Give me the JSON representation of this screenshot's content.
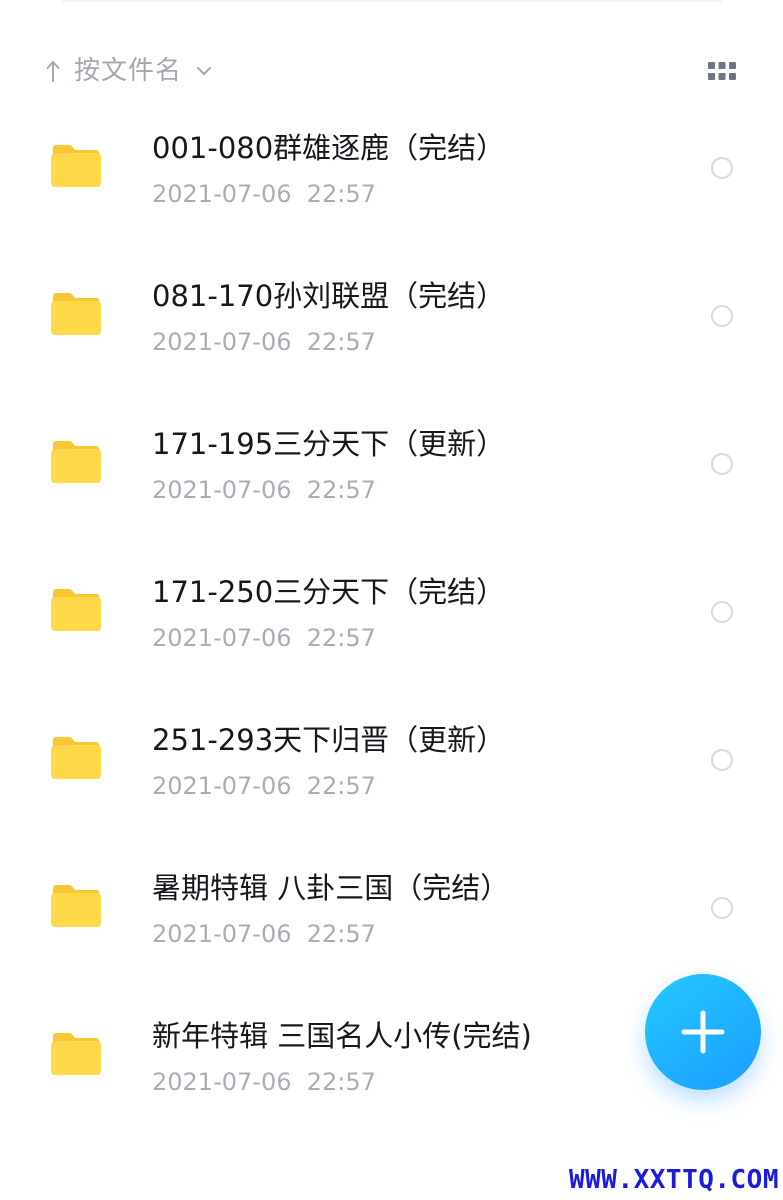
{
  "sort_bar": {
    "sort_direction_icon": "arrow-up-icon",
    "sort_label": "按文件名",
    "dropdown_icon": "chevron-down-icon",
    "view_toggle_icon": "grid-view-icon"
  },
  "files": [
    {
      "name": "001-080群雄逐鹿（完结）",
      "date": "2021-07-06  22:57",
      "icon": "folder-icon"
    },
    {
      "name": "081-170孙刘联盟（完结）",
      "date": "2021-07-06  22:57",
      "icon": "folder-icon"
    },
    {
      "name": "171-195三分天下（更新）",
      "date": "2021-07-06  22:57",
      "icon": "folder-icon"
    },
    {
      "name": "171-250三分天下（完结）",
      "date": "2021-07-06  22:57",
      "icon": "folder-icon"
    },
    {
      "name": "251-293天下归晋（更新）",
      "date": "2021-07-06  22:57",
      "icon": "folder-icon"
    },
    {
      "name": "暑期特辑 八卦三国（完结）",
      "date": "2021-07-06  22:57",
      "icon": "folder-icon"
    },
    {
      "name": "新年特辑 三国名人小传(完结)",
      "date": "2021-07-06  22:57",
      "icon": "folder-icon"
    }
  ],
  "fab": {
    "icon": "plus-icon"
  },
  "watermark": {
    "text": "WWW.XXTTQ.COM"
  },
  "colors": {
    "folder": "#FFD94A",
    "folder_tab": "#F7C634",
    "accent": "#1FB0FF",
    "secondary_text": "#A9ADB6",
    "primary_text": "#16181D"
  }
}
